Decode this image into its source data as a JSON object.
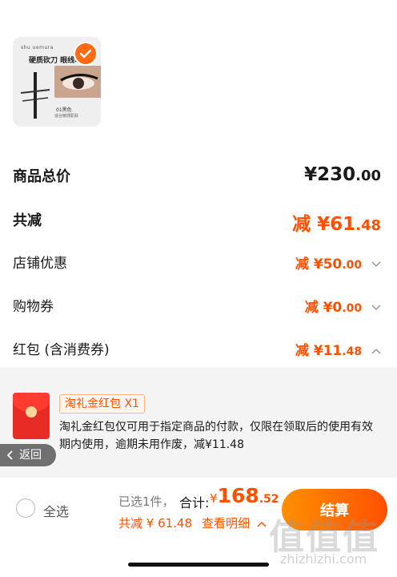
{
  "product": {
    "brand": "shu uemura",
    "title": "硬质砍刀 眼线笔",
    "shade": "01黑色",
    "desc": "适合敏感肌肤",
    "selected": true
  },
  "price_rows": {
    "total_label": "商品总价",
    "total_value_int": "¥230",
    "total_value_dec": ".00",
    "discount_label": "共减",
    "discount_value_int": "减 ¥61",
    "discount_value_dec": ".48",
    "shop_label": "店铺优惠",
    "shop_value_int": "减 ¥50",
    "shop_value_dec": ".00",
    "coupon_label": "购物券",
    "coupon_value_int": "减 ¥0",
    "coupon_value_dec": ".00",
    "redpack_label": "红包 (含消费券)",
    "redpack_value_int": "减 ¥11",
    "redpack_value_dec": ".48"
  },
  "redpack": {
    "tag": "淘礼金红包 X1",
    "text": "淘礼金红包仅可用于指定商品的付款，仅限在领取后的使用有效期内使用，逾期未用作废，减¥11.48"
  },
  "back": {
    "label": "返回"
  },
  "bottom_bar": {
    "select_all": "全选",
    "selected_count": "已选1件，",
    "total_label": "合计:",
    "total_yen": "¥",
    "total_int": "168",
    "total_dec": ".52",
    "saved": "共减 ¥ 61.48",
    "detail": "查看明细",
    "checkout": "结算"
  },
  "watermark": {
    "main": "值值值",
    "sub": "zhizhizhi.com"
  },
  "colors": {
    "accent": "#ff5000",
    "accent_gradient_start": "#ff9000",
    "grey_bg": "#f4f4f4"
  }
}
